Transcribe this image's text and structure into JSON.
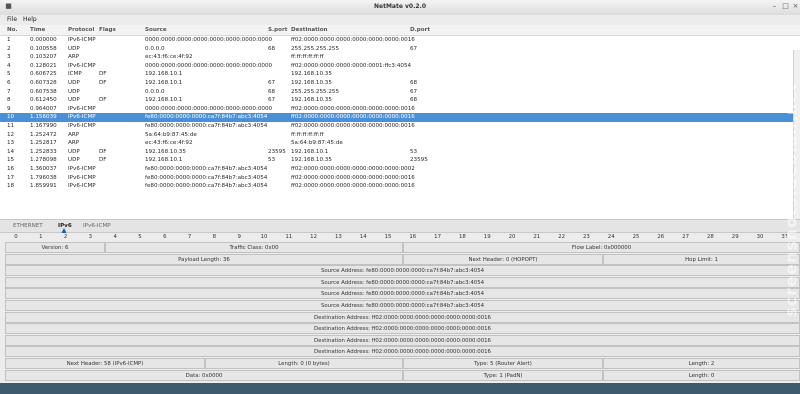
{
  "window": {
    "title": "NetMate v0.2.0"
  },
  "menu": [
    "File",
    "Help"
  ],
  "packet_list": {
    "columns": [
      "No.",
      "Time",
      "Protocol",
      "Flags",
      "Source",
      "S.port",
      "Destination",
      "D.port"
    ],
    "rows": [
      [
        "1",
        "0.000000",
        "IPv6-ICMP",
        "",
        "0000:0000:0000:0000:0000:0000:0000:0000",
        "",
        "ff02:0000:0000:0000:0000:0000:0000:0016",
        ""
      ],
      [
        "2",
        "0.100558",
        "UDP",
        "",
        "0.0.0.0",
        "68",
        "255.255.255.255",
        "67"
      ],
      [
        "3",
        "0.103207",
        "ARP",
        "",
        "ec:43:f6:ce:4f:92",
        "",
        "ff:ff:ff:ff:ff:ff",
        ""
      ],
      [
        "4",
        "0.128021",
        "IPv6-ICMP",
        "",
        "0000:0000:0000:0000:0000:0000:0000:0000",
        "",
        "ff02:0000:0000:0000:0000:0001:ffc3:4054",
        ""
      ],
      [
        "5",
        "0.606725",
        "ICMP",
        "DF",
        "192.168.10.1",
        "",
        "192.168.10.35",
        ""
      ],
      [
        "6",
        "0.607328",
        "UDP",
        "DF",
        "192.168.10.1",
        "67",
        "192.168.10.35",
        "68"
      ],
      [
        "7",
        "0.607538",
        "UDP",
        "",
        "0.0.0.0",
        "68",
        "255.255.255.255",
        "67"
      ],
      [
        "8",
        "0.612450",
        "UDP",
        "DF",
        "192.168.10.1",
        "67",
        "192.168.10.35",
        "68"
      ],
      [
        "9",
        "0.964007",
        "IPv6-ICMP",
        "",
        "0000:0000:0000:0000:0000:0000:0000:0000",
        "",
        "ff02:0000:0000:0000:0000:0000:0000:0016",
        ""
      ],
      [
        "10",
        "1.156039",
        "IPv6-ICMP",
        "",
        "fe80:0000:0000:0000:ca7f:84b7:abc3:4054",
        "",
        "ff02:0000:0000:0000:0000:0000:0000:0016",
        ""
      ],
      [
        "11",
        "1.167990",
        "IPv6-ICMP",
        "",
        "fe80:0000:0000:0000:ca7f:84b7:abc3:4054",
        "",
        "ff02:0000:0000:0000:0000:0000:0000:0016",
        ""
      ],
      [
        "12",
        "1.252472",
        "ARP",
        "",
        "5a:64:b9:87:45:de",
        "",
        "ff:ff:ff:ff:ff:ff",
        ""
      ],
      [
        "13",
        "1.252817",
        "ARP",
        "",
        "ec:43:f6:ce:4f:92",
        "",
        "5a:64:b9:87:45:de",
        ""
      ],
      [
        "14",
        "1.252833",
        "UDP",
        "DF",
        "192.168.10.35",
        "23595",
        "192.168.10.1",
        "53"
      ],
      [
        "15",
        "1.278098",
        "UDP",
        "DF",
        "192.168.10.1",
        "53",
        "192.168.10.35",
        "23595"
      ],
      [
        "16",
        "1.360037",
        "IPv6-ICMP",
        "",
        "fe80:0000:0000:0000:ca7f:84b7:abc3:4054",
        "",
        "ff02:0000:0000:0000:0000:0000:0000:0002",
        ""
      ],
      [
        "17",
        "1.796038",
        "IPv6-ICMP",
        "",
        "fe80:0000:0000:0000:ca7f:84b7:abc3:4054",
        "",
        "ff02:0000:0000:0000:0000:0000:0000:0016",
        ""
      ],
      [
        "18",
        "1.859991",
        "IPv6-ICMP",
        "",
        "fe80:0000:0000:0000:ca7f:84b7:abc3:4054",
        "",
        "ff02:0000:0000:0000:0000:0000:0000:0016",
        ""
      ]
    ],
    "selected_row": 9
  },
  "tabs": [
    {
      "label": "ETHERNET",
      "active": false
    },
    {
      "label": "IPv6",
      "active": true
    },
    {
      "label": "IPv6-ICMP",
      "active": false
    }
  ],
  "ruler": [
    "0",
    "1",
    "2",
    "3",
    "4",
    "5",
    "6",
    "7",
    "8",
    "9",
    "10",
    "11",
    "12",
    "13",
    "14",
    "15",
    "16",
    "17",
    "18",
    "19",
    "20",
    "21",
    "22",
    "23",
    "24",
    "25",
    "26",
    "27",
    "28",
    "29",
    "30",
    "31"
  ],
  "fields": [
    [
      "Version: 6",
      "Traffic Class: 0x00",
      "Flow Label: 0x000000"
    ],
    [
      "Payload Length: 36",
      "Next Header: 0 (HOPOPT)",
      "Hop Limit: 1"
    ],
    [
      "Source Address: fe80:0000:0000:0000:ca7f:84b7:abc3:4054"
    ],
    [
      "Source Address: fe80:0000:0000:0000:ca7f:84b7:abc3:4054"
    ],
    [
      "Source Address: fe80:0000:0000:0000:ca7f:84b7:abc3:4054"
    ],
    [
      "Source Address: fe80:0000:0000:0000:ca7f:84b7:abc3:4054"
    ],
    [
      "Destination Address: ff02:0000:0000:0000:0000:0000:0000:0016"
    ],
    [
      "Destination Address: ff02:0000:0000:0000:0000:0000:0000:0016"
    ],
    [
      "Destination Address: ff02:0000:0000:0000:0000:0000:0000:0016"
    ],
    [
      "Destination Address: ff02:0000:0000:0000:0000:0000:0000:0016"
    ],
    [
      "Next Header: 58 (IPv6-ICMP)",
      "Length: 0 (0 bytes)",
      "Type: 5 (Router Alert)",
      "Length: 2"
    ],
    [
      "Data: 0x0000",
      "Type: 1 (PadN)",
      "Length: 0"
    ]
  ],
  "watermark": "screenshots.debian.net",
  "colors": {
    "selection": "#4a90d9",
    "field_bg": "#e6e6e6"
  }
}
